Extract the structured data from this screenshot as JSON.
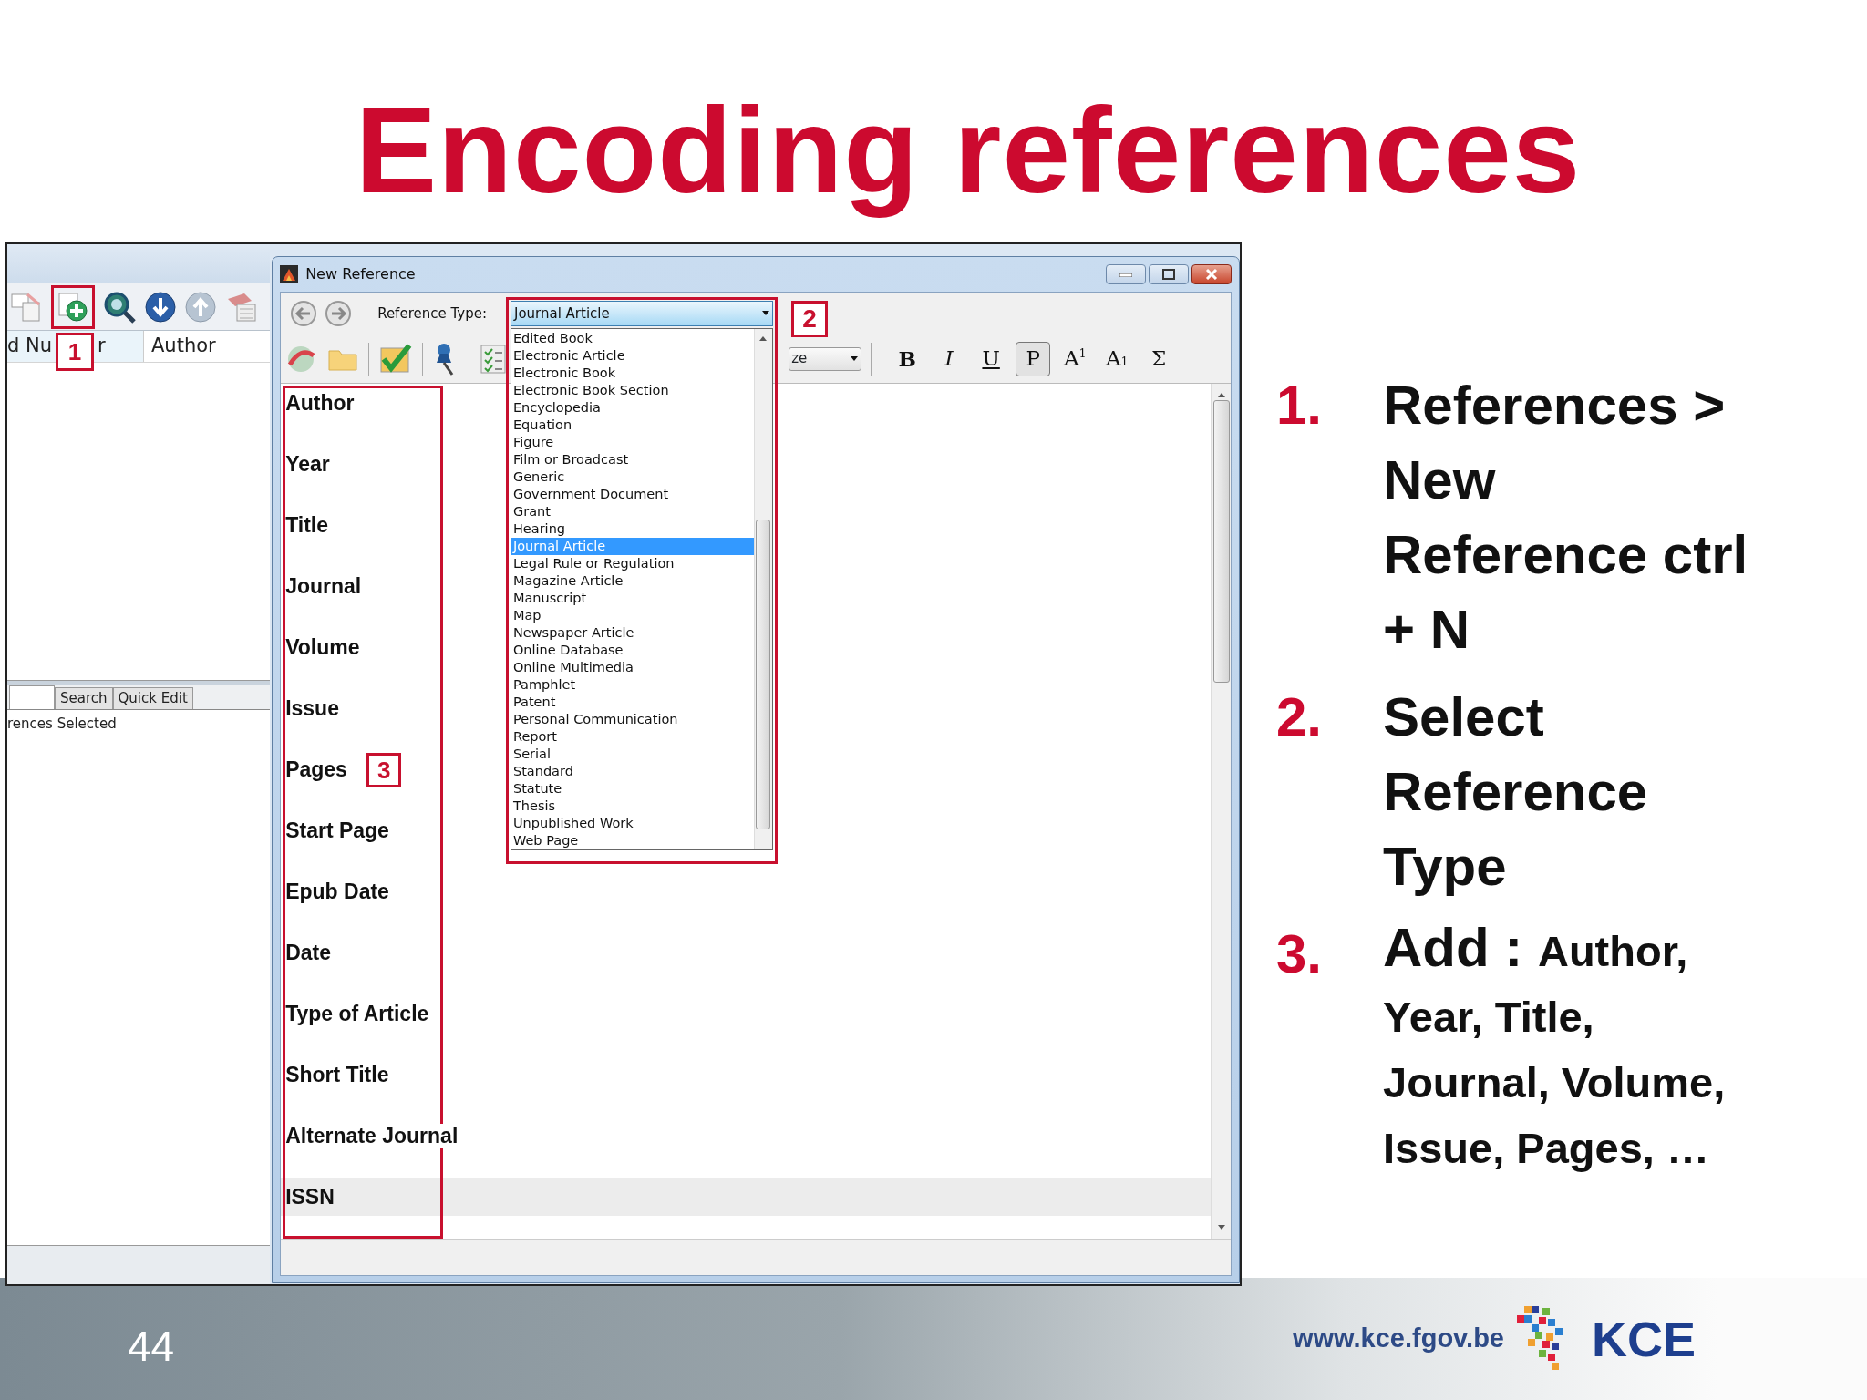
{
  "slide": {
    "title": "Encoding references",
    "page_number": "44",
    "footer_url": "www.kce.fgov.be",
    "logo_text": "KCE"
  },
  "library_window": {
    "columns": [
      {
        "label_before": "d Nu",
        "step_badge": "1",
        "label_after": "r"
      },
      {
        "label": "Author"
      }
    ],
    "tabs": [
      {
        "label": "Search",
        "selected": false
      },
      {
        "label": "Quick Edit",
        "selected": false
      }
    ],
    "status_text": "rences Selected"
  },
  "dialog": {
    "title": "New Reference",
    "reference_type_label": "Reference Type:",
    "reference_type_value": "Journal Article",
    "step_badge_type": "2",
    "reference_types": [
      {
        "label": "Edited Book",
        "selected": false
      },
      {
        "label": "Electronic Article",
        "selected": false
      },
      {
        "label": "Electronic Book",
        "selected": false
      },
      {
        "label": "Electronic Book Section",
        "selected": false
      },
      {
        "label": "Encyclopedia",
        "selected": false
      },
      {
        "label": "Equation",
        "selected": false
      },
      {
        "label": "Figure",
        "selected": false
      },
      {
        "label": "Film or Broadcast",
        "selected": false
      },
      {
        "label": "Generic",
        "selected": false
      },
      {
        "label": "Government Document",
        "selected": false
      },
      {
        "label": "Grant",
        "selected": false
      },
      {
        "label": "Hearing",
        "selected": false
      },
      {
        "label": "Journal Article",
        "selected": true
      },
      {
        "label": "Legal Rule or Regulation",
        "selected": false
      },
      {
        "label": "Magazine Article",
        "selected": false
      },
      {
        "label": "Manuscript",
        "selected": false
      },
      {
        "label": "Map",
        "selected": false
      },
      {
        "label": "Newspaper Article",
        "selected": false
      },
      {
        "label": "Online Database",
        "selected": false
      },
      {
        "label": "Online Multimedia",
        "selected": false
      },
      {
        "label": "Pamphlet",
        "selected": false
      },
      {
        "label": "Patent",
        "selected": false
      },
      {
        "label": "Personal Communication",
        "selected": false
      },
      {
        "label": "Report",
        "selected": false
      },
      {
        "label": "Serial",
        "selected": false
      },
      {
        "label": "Standard",
        "selected": false
      },
      {
        "label": "Statute",
        "selected": false
      },
      {
        "label": "Thesis",
        "selected": false
      },
      {
        "label": "Unpublished Work",
        "selected": false
      },
      {
        "label": "Web Page",
        "selected": false
      }
    ],
    "font_size_text": "ze",
    "format_buttons": [
      {
        "label": "B",
        "kind": "bold",
        "pressed": false
      },
      {
        "label": "I",
        "kind": "italic",
        "pressed": false
      },
      {
        "label": "U",
        "kind": "underline",
        "pressed": false
      },
      {
        "label": "P",
        "kind": "plain",
        "pressed": true
      },
      {
        "label": "A$^{1}$",
        "kind": "superscript",
        "pressed": false
      },
      {
        "label": "A$_{1}$",
        "kind": "subscript",
        "pressed": false
      },
      {
        "label": "Σ",
        "kind": "symbol",
        "pressed": false
      }
    ],
    "step_badge_fields": "3",
    "fields": [
      {
        "label": "Author",
        "focused": false
      },
      {
        "label": "Year",
        "focused": false
      },
      {
        "label": "Title",
        "focused": false
      },
      {
        "label": "Journal",
        "focused": false
      },
      {
        "label": "Volume",
        "focused": false
      },
      {
        "label": "Issue",
        "focused": false
      },
      {
        "label": "Pages",
        "focused": false
      },
      {
        "label": "Start Page",
        "focused": false
      },
      {
        "label": "Epub Date",
        "focused": false
      },
      {
        "label": "Date",
        "focused": false
      },
      {
        "label": "Type of Article",
        "focused": false
      },
      {
        "label": "Short Title",
        "focused": false
      },
      {
        "label": "Alternate Journal",
        "focused": false
      },
      {
        "label": "ISSN",
        "focused": true
      }
    ]
  },
  "instructions": [
    {
      "number": "1.",
      "text": "References > New Reference ctrl + N"
    },
    {
      "number": "2.",
      "text": "Select Reference Type"
    },
    {
      "number": "3.",
      "heading": "Add :",
      "text": "Author, Year, Title, Journal, Volume, Issue, Pages, …"
    }
  ]
}
